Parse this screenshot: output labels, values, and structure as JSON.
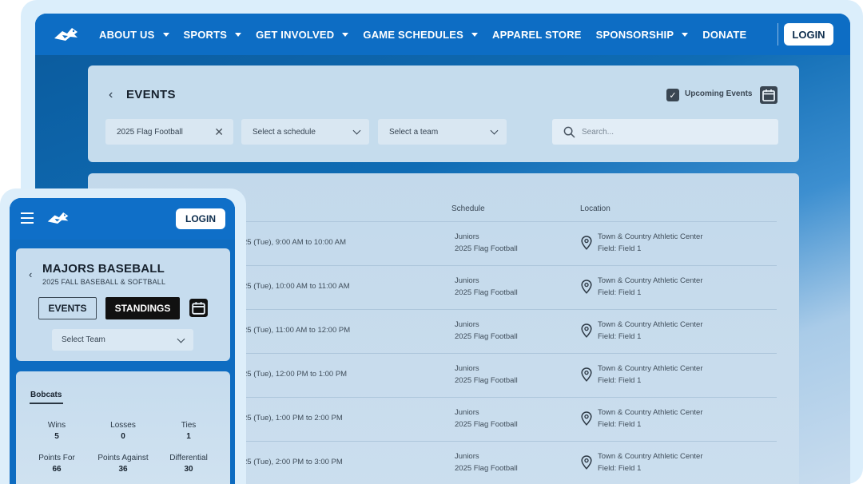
{
  "nav": {
    "items": [
      {
        "label": "ABOUT US",
        "dropdown": true
      },
      {
        "label": "SPORTS",
        "dropdown": true
      },
      {
        "label": "GET INVOLVED",
        "dropdown": true
      },
      {
        "label": "GAME SCHEDULES",
        "dropdown": true
      },
      {
        "label": "APPAREL STORE",
        "dropdown": false
      },
      {
        "label": "SPONSORSHIP",
        "dropdown": true
      },
      {
        "label": "DONATE",
        "dropdown": false
      }
    ],
    "login_label": "LOGIN"
  },
  "events": {
    "title": "EVENTS",
    "upcoming_label": "Upcoming Events",
    "filter_program": "2025 Flag Football",
    "filter_schedule_placeholder": "Select a schedule",
    "filter_team_placeholder": "Select a team",
    "search_placeholder": "Search...",
    "col_schedule": "Schedule",
    "col_location": "Location",
    "rows": [
      {
        "time": "25 (Tue), 9:00 AM to 10:00 AM",
        "schedule_level": "Juniors",
        "schedule_program": "2025 Flag Football",
        "venue": "Town & Country Athletic Center",
        "field": "Field: Field 1"
      },
      {
        "time": "25 (Tue), 10:00 AM to 11:00 AM",
        "schedule_level": "Juniors",
        "schedule_program": "2025 Flag Football",
        "venue": "Town & Country Athletic Center",
        "field": "Field: Field 1"
      },
      {
        "time": "25 (Tue), 11:00 AM to 12:00 PM",
        "schedule_level": "Juniors",
        "schedule_program": "2025 Flag Football",
        "venue": "Town & Country Athletic Center",
        "field": "Field: Field 1"
      },
      {
        "time": "25 (Tue), 12:00 PM to 1:00 PM",
        "schedule_level": "Juniors",
        "schedule_program": "2025 Flag Football",
        "venue": "Town & Country Athletic Center",
        "field": "Field: Field 1"
      },
      {
        "time": "25 (Tue), 1:00 PM to 2:00 PM",
        "schedule_level": "Juniors",
        "schedule_program": "2025 Flag Football",
        "venue": "Town & Country Athletic Center",
        "field": "Field: Field 1"
      },
      {
        "time": "25 (Tue), 2:00 PM to 3:00 PM",
        "schedule_level": "Juniors",
        "schedule_program": "2025 Flag Football",
        "venue": "Town & Country Athletic Center",
        "field": "Field: Field 1"
      }
    ]
  },
  "mobile": {
    "login_label": "LOGIN",
    "title": "MAJORS BASEBALL",
    "subtitle": "2025 FALL BASEBALL & SOFTBALL",
    "tab_events": "EVENTS",
    "tab_standings": "STANDINGS",
    "select_team": "Select Team",
    "team_name": "Bobcats",
    "stats": [
      {
        "label": "Wins",
        "value": "5"
      },
      {
        "label": "Losses",
        "value": "0"
      },
      {
        "label": "Ties",
        "value": "1"
      },
      {
        "label": "Points For",
        "value": "66"
      },
      {
        "label": "Points Against",
        "value": "36"
      },
      {
        "label": "Differential",
        "value": "30"
      }
    ]
  },
  "icons": {
    "logo": "bird-logo-icon",
    "calendar": "calendar-icon",
    "search": "search-icon",
    "location": "map-pin-icon",
    "menu": "hamburger-menu-icon"
  },
  "colors": {
    "nav_blue": "#0d6dc4",
    "card_bg": "#c5dced",
    "dark_button": "#111111"
  }
}
